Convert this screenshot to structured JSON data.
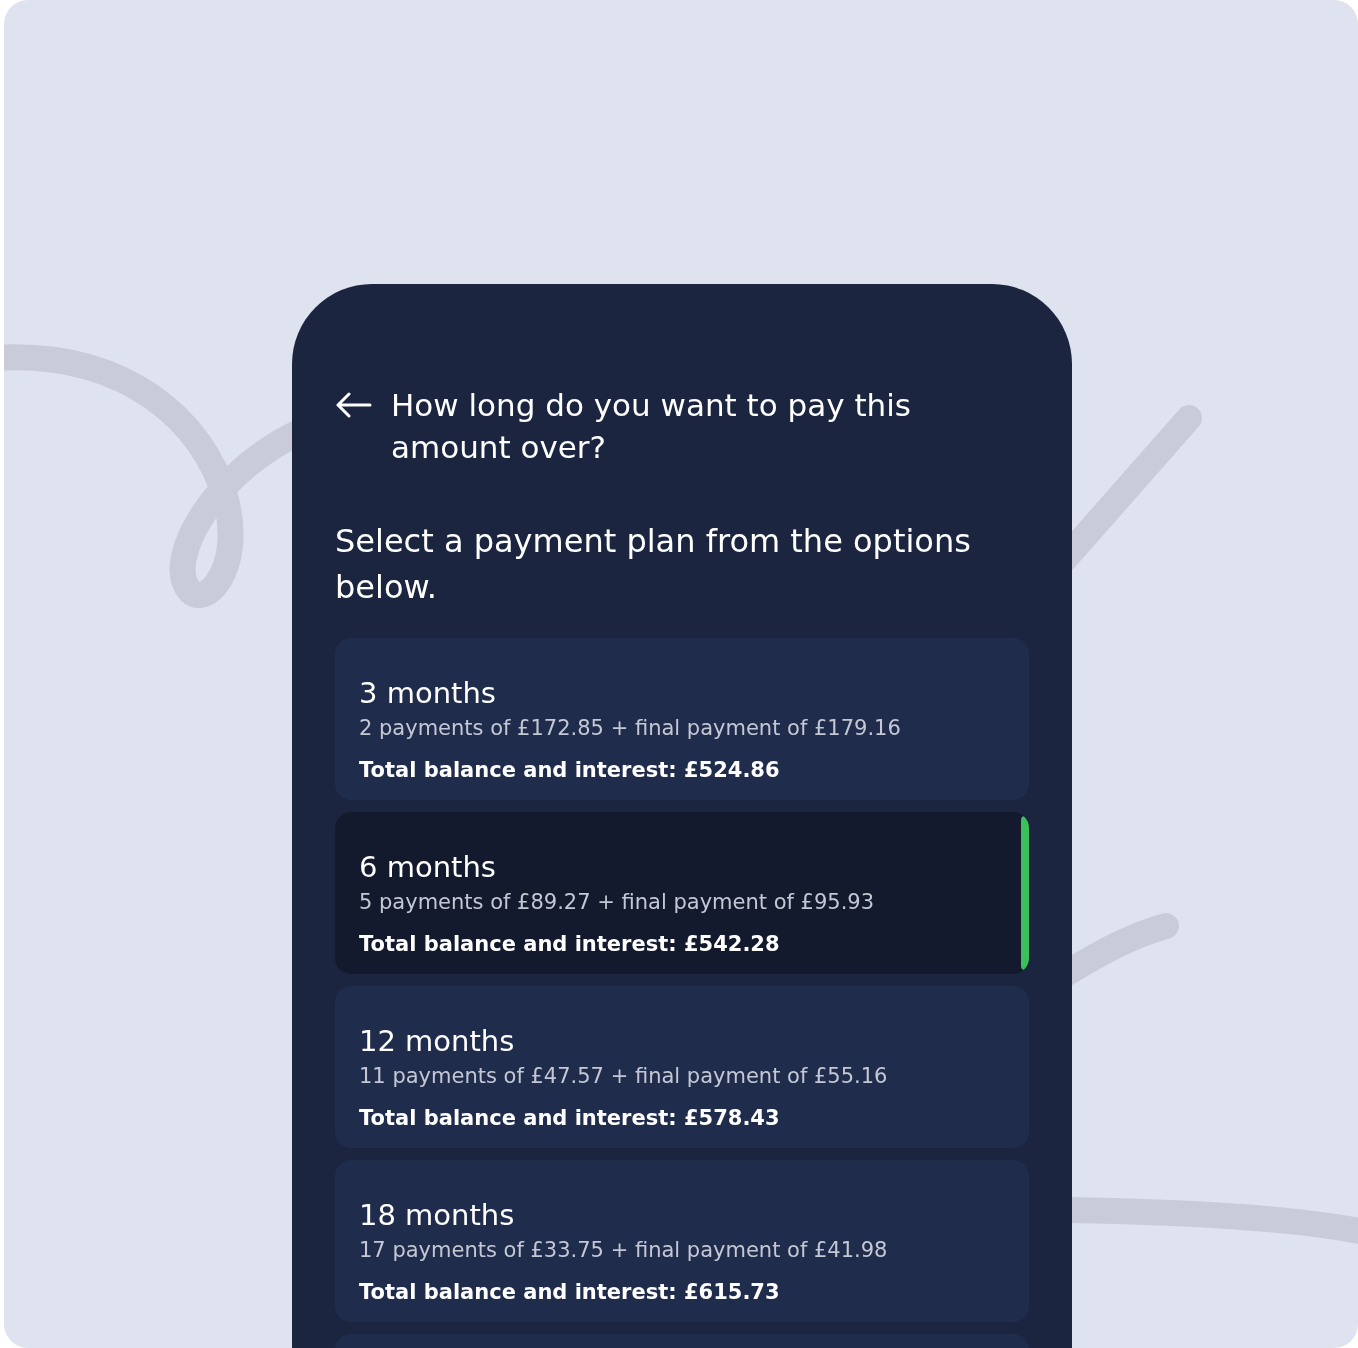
{
  "header": {
    "title": "How long do you want to pay this amount over?"
  },
  "intro": "Select a payment plan from the options below.",
  "plans": [
    {
      "title": "3 months",
      "payments": "2 payments of £172.85 + final payment of £179.16",
      "total": "Total balance and interest: £524.86",
      "selected": false
    },
    {
      "title": "6 months",
      "payments": "5 payments of £89.27 + final payment of £95.93",
      "total": "Total balance and interest: £542.28",
      "selected": true
    },
    {
      "title": "12 months",
      "payments": "11 payments of £47.57 + final payment of £55.16",
      "total": "Total balance and interest: £578.43",
      "selected": false
    },
    {
      "title": "18 months",
      "payments": "17 payments of £33.75 + final payment of £41.98",
      "total": "Total balance and interest: £615.73",
      "selected": false
    }
  ]
}
